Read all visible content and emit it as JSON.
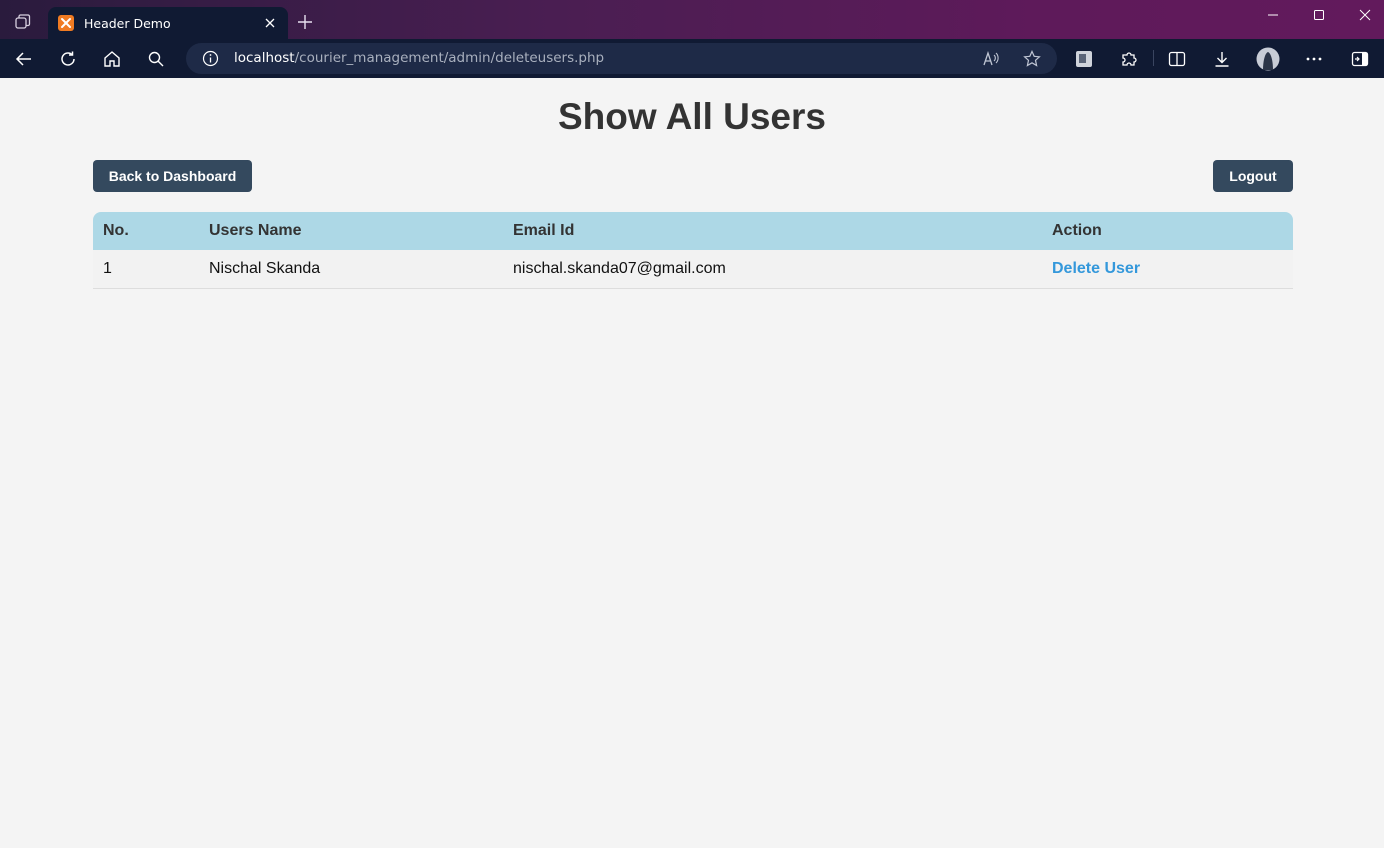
{
  "browser": {
    "tab_title": "Header Demo",
    "url_host": "localhost",
    "url_path": "/courier_management/admin/deleteusers.php"
  },
  "page": {
    "title": "Show All Users",
    "back_button": "Back to Dashboard",
    "logout_button": "Logout"
  },
  "table": {
    "headers": [
      "No.",
      "Users Name",
      "Email Id",
      "Action"
    ],
    "rows": [
      {
        "no": "1",
        "name": "Nischal Skanda",
        "email": "nischal.skanda07@gmail.com",
        "action": "Delete User"
      }
    ]
  },
  "colors": {
    "button_bg": "#34495e",
    "table_header_bg": "#add8e6",
    "link": "#3498db",
    "page_bg": "#f4f4f4"
  }
}
